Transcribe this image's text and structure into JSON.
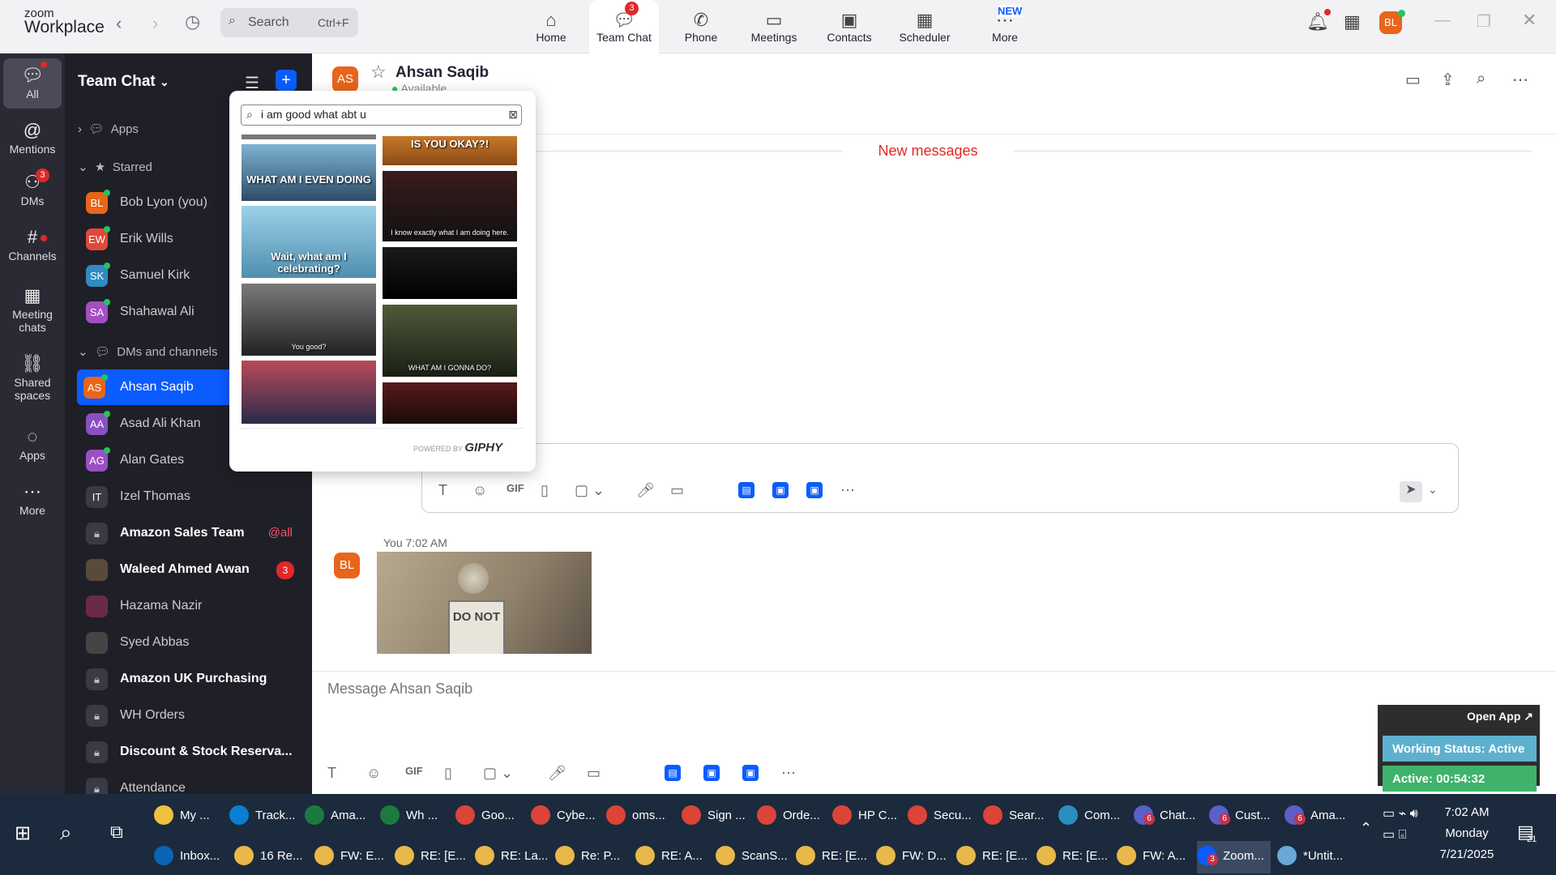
{
  "app": {
    "brand_line1": "zoom",
    "brand_line2": "Workplace"
  },
  "topbar": {
    "search_placeholder": "Search",
    "search_shortcut": "Ctrl+F",
    "tabs": [
      {
        "label": "Home",
        "icon": "home-icon"
      },
      {
        "label": "Team Chat",
        "icon": "chat-icon",
        "badge": "3"
      },
      {
        "label": "Phone",
        "icon": "phone-icon"
      },
      {
        "label": "Meetings",
        "icon": "video-icon"
      },
      {
        "label": "Contacts",
        "icon": "contacts-icon"
      },
      {
        "label": "Scheduler",
        "icon": "calendar-icon"
      },
      {
        "label": "More",
        "icon": "more-icon",
        "badge": "NEW"
      }
    ],
    "avatar_initials": "BL"
  },
  "rail": {
    "items": [
      {
        "label": "All",
        "icon": "chat-bubble-icon"
      },
      {
        "label": "Mentions",
        "icon": "at-icon"
      },
      {
        "label": "DMs",
        "icon": "people-icon",
        "badge": "3"
      },
      {
        "label": "Channels",
        "icon": "hash-icon"
      },
      {
        "label": "Meeting chats",
        "icon": "calendar-icon"
      },
      {
        "label": "Shared spaces",
        "icon": "shared-icon"
      },
      {
        "label": "Apps",
        "icon": "apps-icon"
      },
      {
        "label": "More",
        "icon": "more-icon"
      }
    ]
  },
  "sidebar": {
    "title": "Team Chat",
    "sections": {
      "apps": "Apps",
      "starred": "Starred",
      "dms": "DMs and channels"
    },
    "starred": [
      {
        "initials": "BL",
        "name": "Bob Lyon (you)",
        "color": "#e8651a"
      },
      {
        "initials": "EW",
        "name": "Erik Wills",
        "color": "#e0493a"
      },
      {
        "initials": "SK",
        "name": "Samuel Kirk",
        "color": "#2e8bc0"
      },
      {
        "initials": "SA",
        "name": "Shahawal Ali",
        "color": "#a34fc2"
      }
    ],
    "dms": [
      {
        "initials": "AS",
        "name": "Ahsan Saqib",
        "color": "#e8651a"
      },
      {
        "initials": "AA",
        "name": "Asad Ali Khan",
        "color": "#8a4fc2"
      },
      {
        "initials": "AG",
        "name": "Alan Gates",
        "color": "#9b4fc2"
      },
      {
        "initials": "IT",
        "name": "Izel Thomas",
        "color": "#3a3a46"
      },
      {
        "initials": "",
        "name": "Amazon Sales Team",
        "color": "#3a3a46",
        "tag": "@all"
      },
      {
        "initials": "",
        "name": "Waleed Ahmed Awan",
        "color": "#5a4a3a",
        "badge": "3"
      },
      {
        "initials": "",
        "name": "Hazama Nazir",
        "color": "#6a2a4a"
      },
      {
        "initials": "",
        "name": "Syed Abbas",
        "color": "#444"
      },
      {
        "initials": "",
        "name": "Amazon UK Purchasing",
        "color": "#3a3a46"
      },
      {
        "initials": "",
        "name": "WH Orders",
        "color": "#3a3a46"
      },
      {
        "initials": "",
        "name": "Discount & Stock Reserva...",
        "color": "#3a3a46"
      },
      {
        "initials": "",
        "name": "Attendance",
        "color": "#3a3a46"
      }
    ]
  },
  "chat": {
    "contact_initials": "AS",
    "contact_name": "Ahsan Saqib",
    "contact_status": "Available",
    "new_messages": "New messages",
    "message_meta": "You 7:02 AM",
    "message_image_text": "DO NOT",
    "input_placeholder": "Message Ahsan Saqib"
  },
  "giphy": {
    "query": "i am good what abt u",
    "gifs": [
      {
        "caption": "WHAT AM I EVEN DOING"
      },
      {
        "caption": "IS YOU OKAY?!"
      },
      {
        "caption": "Wait, what am I celebrating?"
      },
      {
        "caption": "I know exactly what I am doing here."
      },
      {
        "caption": "You good?"
      },
      {
        "caption": ""
      },
      {
        "caption": ""
      },
      {
        "caption": "WHAT AM I GONNA DO?"
      },
      {
        "caption": ""
      },
      {
        "caption": ""
      }
    ],
    "powered_by": "POWERED BY",
    "brand": "GIPHY"
  },
  "composer_icons": [
    "format-icon",
    "emoji-icon",
    "gif-icon",
    "file-icon",
    "screenshot-icon",
    "mic-icon",
    "video-message-icon",
    "code-icon",
    "app1-icon",
    "app2-icon",
    "app3-icon",
    "more-icon"
  ],
  "widgets": {
    "open_app": "Open App ↗",
    "working_status": "Working Status: Active",
    "active_timer": "Active: 00:54:32"
  },
  "taskbar": {
    "row1": [
      {
        "label": "My ...",
        "color": "#f0c040"
      },
      {
        "label": "Track...",
        "color": "#0a7fd4"
      },
      {
        "label": "Ama...",
        "color": "#1d7a3e"
      },
      {
        "label": "Wh ...",
        "color": "#1d7a3e"
      },
      {
        "label": "Goo...",
        "color": "#db4437"
      },
      {
        "label": "Cybe...",
        "color": "#db4437"
      },
      {
        "label": "oms...",
        "color": "#db4437"
      },
      {
        "label": "Sign ...",
        "color": "#db4437"
      },
      {
        "label": "Orde...",
        "color": "#db4437"
      },
      {
        "label": "HP C...",
        "color": "#db4437"
      },
      {
        "label": "Secu...",
        "color": "#db4437"
      },
      {
        "label": "Sear...",
        "color": "#db4437"
      },
      {
        "label": "Com...",
        "color": "#2a8fbf"
      },
      {
        "label": "Chat...",
        "color": "#5b5fc7",
        "badge": "6"
      },
      {
        "label": "Cust...",
        "color": "#5b5fc7",
        "badge": "6"
      },
      {
        "label": "Ama...",
        "color": "#5b5fc7",
        "badge": "6"
      }
    ],
    "row2": [
      {
        "label": "Inbox...",
        "color": "#0a64b4"
      },
      {
        "label": "16 Re...",
        "color": "#e8b84a"
      },
      {
        "label": "FW: E...",
        "color": "#e8b84a"
      },
      {
        "label": "RE: [E...",
        "color": "#e8b84a"
      },
      {
        "label": "RE: La...",
        "color": "#e8b84a"
      },
      {
        "label": "Re: P...",
        "color": "#e8b84a"
      },
      {
        "label": "RE: A...",
        "color": "#e8b84a"
      },
      {
        "label": "ScanS...",
        "color": "#e8b84a"
      },
      {
        "label": "RE: [E...",
        "color": "#e8b84a"
      },
      {
        "label": "FW: D...",
        "color": "#e8b84a"
      },
      {
        "label": "RE: [E...",
        "color": "#e8b84a"
      },
      {
        "label": "RE: [E...",
        "color": "#e8b84a"
      },
      {
        "label": "FW: A...",
        "color": "#e8b84a"
      },
      {
        "label": "Zoom...",
        "color": "#0b5cff",
        "badge": "3"
      },
      {
        "label": "*Untit...",
        "color": "#6aa8d8"
      }
    ],
    "time": "7:02 AM",
    "day": "Monday",
    "date": "7/21/2025",
    "notification_count": "21"
  }
}
